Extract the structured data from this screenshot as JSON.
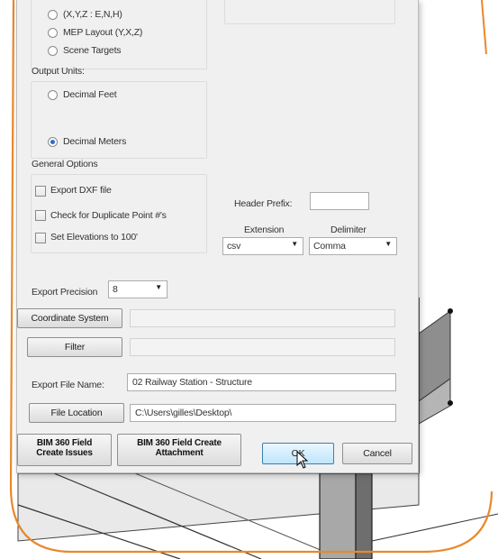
{
  "coordinate_format": {
    "options": [
      {
        "label": "(X,Y,Z : E,N,H)",
        "selected": false
      },
      {
        "label": "MEP Layout (Y,X,Z)",
        "selected": false
      },
      {
        "label": "Scene Targets",
        "selected": false
      }
    ]
  },
  "output_units": {
    "title": "Output Units:",
    "options": [
      {
        "label": "Decimal Feet",
        "selected": false
      },
      {
        "label": "Decimal Meters",
        "selected": true
      }
    ]
  },
  "general_options": {
    "title": "General Options",
    "checkboxes": [
      {
        "label": "Export DXF file",
        "checked": false
      },
      {
        "label": "Check for Duplicate Point #'s",
        "checked": false
      },
      {
        "label": "Set Elevations to 100'",
        "checked": false
      }
    ]
  },
  "header_prefix": {
    "label": "Header Prefix:",
    "value": ""
  },
  "extension": {
    "label": "Extension",
    "value": "csv"
  },
  "delimiter": {
    "label": "Delimiter",
    "value": "Comma"
  },
  "export_precision": {
    "label": "Export Precision",
    "value": "8"
  },
  "coordinate_system": {
    "button": "Coordinate System",
    "value": ""
  },
  "filter": {
    "button": "Filter",
    "value": ""
  },
  "export_file_name": {
    "label": "Export File Name:",
    "value": "02 Railway Station - Structure"
  },
  "file_location": {
    "button": "File Location",
    "value": "C:\\Users\\gilles\\Desktop\\"
  },
  "buttons": {
    "bim_issues_line1": "BIM 360 Field",
    "bim_issues_line2": "Create Issues",
    "bim_attach_line1": "BIM 360 Field Create",
    "bim_attach_line2": "Attachment",
    "ok": "OK",
    "cancel": "Cancel"
  },
  "colors": {
    "accent_orange": "#e8892b",
    "radio_selected": "#2d6ec9",
    "default_button_border": "#3c7fb1"
  }
}
